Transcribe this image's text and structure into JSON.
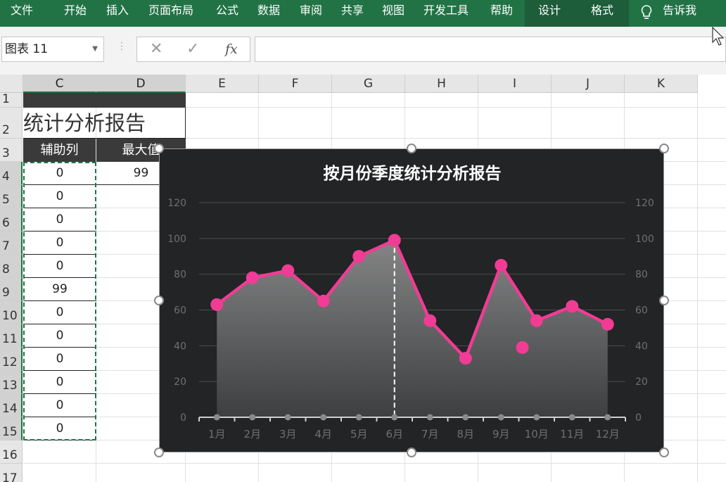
{
  "ribbon": {
    "tabs": [
      "文件",
      "开始",
      "插入",
      "页面布局",
      "公式",
      "数据",
      "审阅",
      "共享",
      "视图",
      "开发工具",
      "帮助"
    ],
    "contextual_tabs": [
      "设计",
      "格式"
    ],
    "tell_me": "告诉我"
  },
  "formula_bar": {
    "name_box": "图表 11",
    "cancel_icon": "✕",
    "enter_icon": "✓",
    "fx_label": "fx",
    "formula": ""
  },
  "sheet": {
    "columns": [
      "C",
      "D",
      "E",
      "F",
      "G",
      "H",
      "I",
      "J",
      "K"
    ],
    "rows": [
      "1",
      "2",
      "3",
      "4",
      "5",
      "6",
      "7",
      "8",
      "9",
      "10",
      "11",
      "12",
      "13",
      "14",
      "15",
      "16",
      "17"
    ],
    "title_text": "统计分析报告",
    "header_c": "辅助列",
    "header_d": "最大值",
    "helper_values": [
      "0",
      "0",
      "0",
      "0",
      "0",
      "99",
      "0",
      "0",
      "0",
      "0",
      "0",
      "0"
    ],
    "max_value": "99"
  },
  "colors": {
    "ribbon": "#217346",
    "chart_bg": "#222426",
    "series": "#f03c94",
    "area": "#8a8a8a"
  },
  "chart_data": {
    "type": "line",
    "title": "按月份季度统计分析报告",
    "categories": [
      "1月",
      "2月",
      "3月",
      "4月",
      "5月",
      "6月",
      "7月",
      "8月",
      "9月",
      "10月",
      "11月",
      "12月"
    ],
    "series": [
      {
        "values": [
          63,
          78,
          82,
          65,
          90,
          99,
          54,
          33,
          85,
          54,
          62,
          52
        ]
      }
    ],
    "extra_marker": {
      "x": 9.6,
      "y": 39
    },
    "max_marker_category": "6月",
    "ylim": [
      0,
      120
    ],
    "yticks": [
      0,
      20,
      40,
      60,
      80,
      100,
      120
    ],
    "secondary_yticks": [
      0,
      20,
      40,
      60,
      80,
      100,
      120
    ],
    "grid": true,
    "legend": "none"
  }
}
